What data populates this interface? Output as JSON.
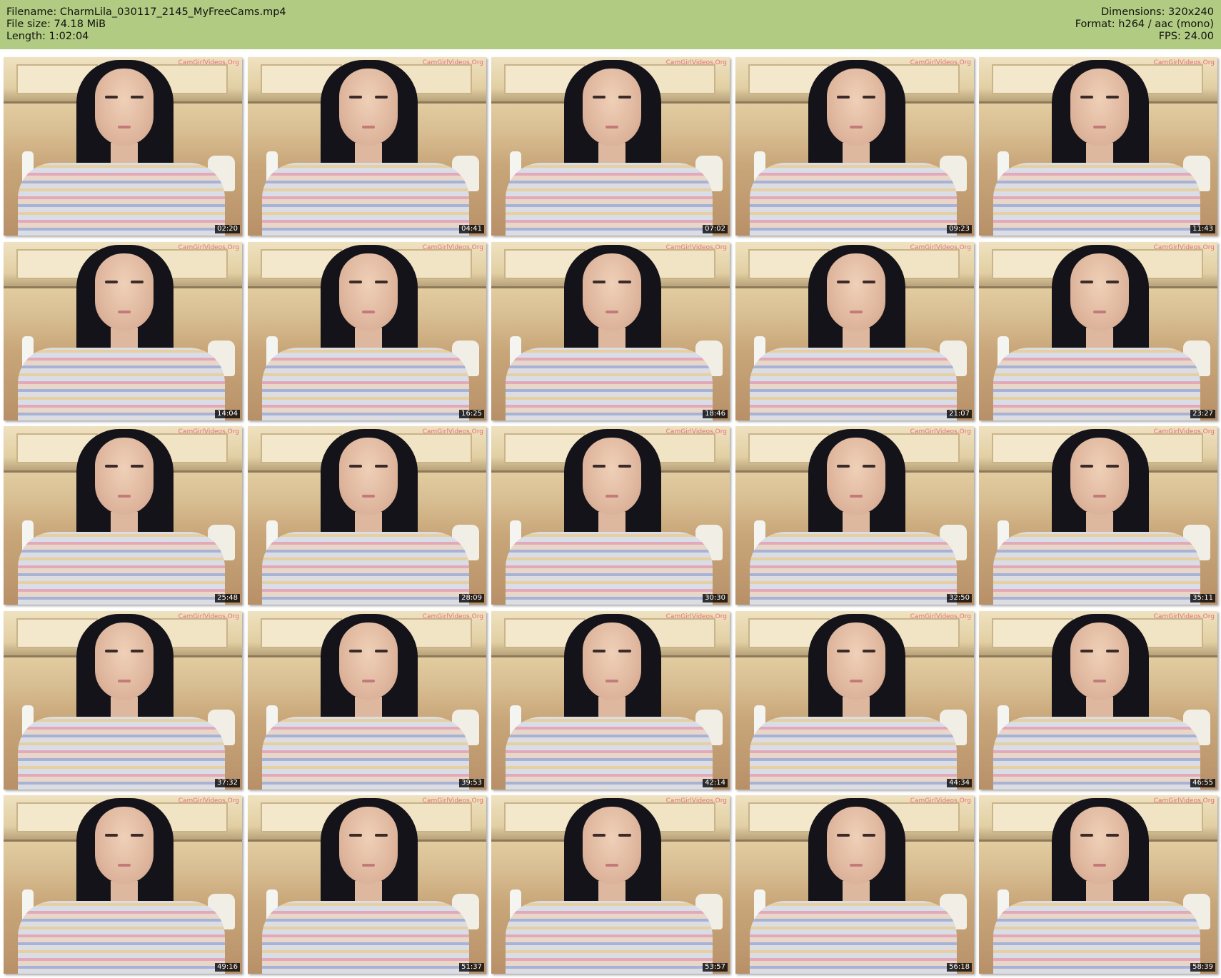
{
  "header": {
    "filename": "Filename: CharmLila_030117_2145_MyFreeCams.mp4",
    "filesize": "File size: 74.18 MiB",
    "length": "Length: 1:02:04",
    "dimensions": "Dimensions: 320x240",
    "format": "Format: h264 / aac (mono)",
    "fps": "FPS: 24.00"
  },
  "watermark": "CamGirlVideos.Org",
  "thumbnails": [
    {
      "time": "02:20"
    },
    {
      "time": "04:41"
    },
    {
      "time": "07:02"
    },
    {
      "time": "09:23"
    },
    {
      "time": "11:43"
    },
    {
      "time": "14:04"
    },
    {
      "time": "16:25"
    },
    {
      "time": "18:46"
    },
    {
      "time": "21:07"
    },
    {
      "time": "23:27"
    },
    {
      "time": "25:48"
    },
    {
      "time": "28:09"
    },
    {
      "time": "30:30"
    },
    {
      "time": "32:50"
    },
    {
      "time": "35:11"
    },
    {
      "time": "37:32"
    },
    {
      "time": "39:53"
    },
    {
      "time": "42:14"
    },
    {
      "time": "44:34"
    },
    {
      "time": "46:55"
    },
    {
      "time": "49:16"
    },
    {
      "time": "51:37"
    },
    {
      "time": "53:57"
    },
    {
      "time": "56:18"
    },
    {
      "time": "58:39"
    }
  ]
}
